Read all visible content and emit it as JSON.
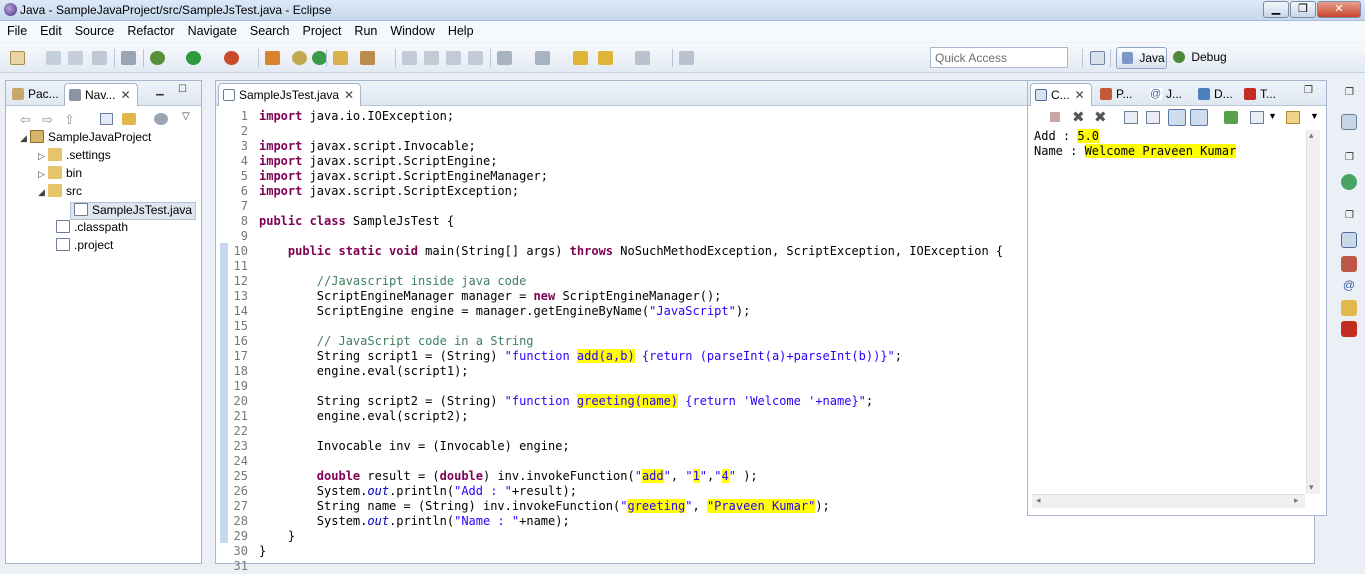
{
  "window": {
    "title": "Java - SampleJavaProject/src/SampleJsTest.java - Eclipse",
    "min_label": "▁",
    "max_label": "❐",
    "close_label": "✕"
  },
  "menu": [
    "File",
    "Edit",
    "Source",
    "Refactor",
    "Navigate",
    "Search",
    "Project",
    "Run",
    "Window",
    "Help"
  ],
  "toolbar": {
    "quick_access_placeholder": "Quick Access",
    "perspective_java": "Java",
    "perspective_debug": "Debug"
  },
  "left_panel": {
    "tabs": [
      "Pac...",
      "Nav..."
    ],
    "tree": [
      {
        "label": "SampleJavaProject",
        "arrow": "◢",
        "icon": "project-icon"
      },
      {
        "label": ".settings",
        "arrow": "▷",
        "icon": "folder-icon"
      },
      {
        "label": "bin",
        "arrow": "▷",
        "icon": "folder-icon"
      },
      {
        "label": "src",
        "arrow": "◢",
        "icon": "folder-icon"
      },
      {
        "label": "SampleJsTest.java",
        "arrow": "",
        "icon": "java-file-icon"
      },
      {
        "label": ".classpath",
        "arrow": "",
        "icon": "xml-file-icon"
      },
      {
        "label": ".project",
        "arrow": "",
        "icon": "xml-file-icon"
      }
    ]
  },
  "editor": {
    "tab_label": "SampleJsTest.java",
    "line_numbers": [
      "1",
      "2",
      "3",
      "4",
      "5",
      "6",
      "7",
      "8",
      "9",
      "10",
      "11",
      "12",
      "13",
      "14",
      "15",
      "16",
      "17",
      "18",
      "19",
      "20",
      "21",
      "22",
      "23",
      "24",
      "25",
      "26",
      "27",
      "28",
      "29",
      "30",
      "31"
    ]
  },
  "console": {
    "tabs": [
      "C...",
      "P...",
      "J...",
      "D...",
      "T..."
    ],
    "add_label": "Add : ",
    "add_value": "5.0",
    "name_label": "Name : ",
    "name_value": "Welcome Praveen Kumar"
  },
  "colors": {
    "keyword": "#7f0055",
    "string": "#2a00ff",
    "comment": "#3f7f5f",
    "highlight": "#ffff00"
  }
}
